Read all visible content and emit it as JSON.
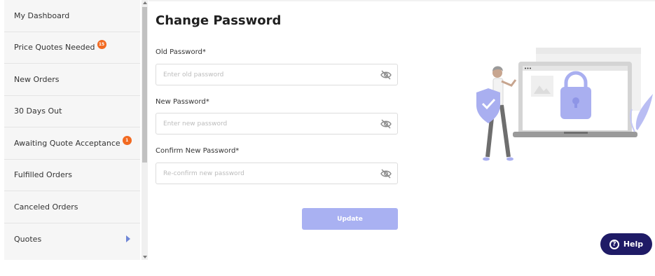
{
  "sidebar": {
    "items": [
      {
        "label": "My Dashboard",
        "badge": ""
      },
      {
        "label": "Price Quotes Needed",
        "badge": "15"
      },
      {
        "label": "New Orders",
        "badge": ""
      },
      {
        "label": "30 Days Out",
        "badge": ""
      },
      {
        "label": "Awaiting Quote Acceptance",
        "badge": "1"
      },
      {
        "label": "Fulfilled Orders",
        "badge": ""
      },
      {
        "label": "Canceled Orders",
        "badge": ""
      },
      {
        "label": "Quotes",
        "badge": ""
      }
    ]
  },
  "page": {
    "title": "Change Password"
  },
  "form": {
    "old_label": "Old Password*",
    "old_placeholder": "Enter old password",
    "new_label": "New Password*",
    "new_placeholder": "Enter new password",
    "confirm_label": "Confirm New Password*",
    "confirm_placeholder": "Re-confirm new password",
    "update_label": "Update"
  },
  "help": {
    "label": "Help",
    "icon": "question-icon"
  },
  "colors": {
    "accent": "#a9b1f2",
    "badge": "#f26a21",
    "help_bg": "#1f1b66"
  }
}
